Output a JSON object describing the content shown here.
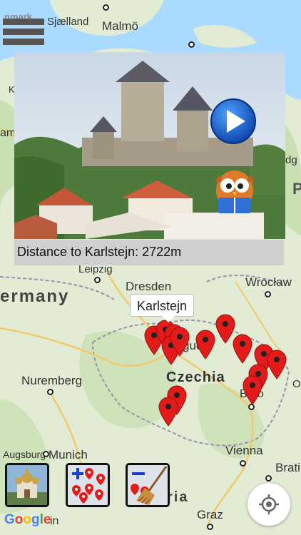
{
  "header": {
    "menu_icon": "hamburger-menu-icon",
    "partial_title": "nmark"
  },
  "map": {
    "cities": {
      "sjaelland": "Sjælland",
      "malmo": "Malmö",
      "leipzig": "Leipzig",
      "dresden": "Dresden",
      "wroclaw": "Wrocław",
      "nuremberg": "Nuremberg",
      "augsburg": "Augsburg",
      "munich": "Munich",
      "vienna": "Vienna",
      "graz": "Graz",
      "brno": "Brno",
      "bratislava": "Brati",
      "prague": "gue",
      "germany": "ermany",
      "czechia": "Czechia",
      "austria": "ria",
      "edge_p": "P",
      "edge_o": "O",
      "edge_k": "K",
      "edge_amb": "amb",
      "edge_dg": "dg",
      "edge_in": "in"
    },
    "selected_place": "Karlstejn"
  },
  "place_card": {
    "distance_text": "Distance to Karlstejn: 2722m",
    "play_icon": "play-icon",
    "owl_icon": "owl-reading-icon"
  },
  "toolbar": {
    "gallery_icon": "church-photo-icon",
    "add_pins_icon": "add-pins-icon",
    "clear_pins_icon": "clear-pins-broom-icon",
    "locate_icon": "my-location-icon"
  },
  "google_logo": "Google",
  "colors": {
    "pin": "#e31b1b",
    "water": "#aadaff",
    "land": "#e2ecd4"
  }
}
